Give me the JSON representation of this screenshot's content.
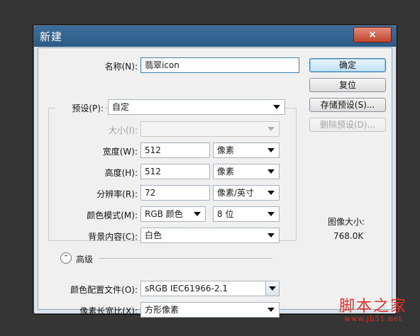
{
  "dialog": {
    "title": "新建",
    "close_label": "×"
  },
  "form": {
    "name": {
      "label": "名称(N):",
      "value": "翡翠icon"
    },
    "preset": {
      "label": "预设(P):",
      "value": "自定"
    },
    "size": {
      "label": "大小(I):",
      "value": ""
    },
    "width": {
      "label": "宽度(W):",
      "value": "512",
      "unit": "像素"
    },
    "height": {
      "label": "高度(H):",
      "value": "512",
      "unit": "像素"
    },
    "resolution": {
      "label": "分辨率(R):",
      "value": "72",
      "unit": "像素/英寸"
    },
    "color_mode": {
      "label": "颜色模式(M):",
      "value": "RGB 颜色",
      "depth": "8 位"
    },
    "background": {
      "label": "背景内容(C):",
      "value": "白色"
    },
    "advanced": {
      "label": "高级",
      "toggle_glyph": "⌃"
    },
    "color_profile": {
      "label": "颜色配置文件(O):",
      "value": "sRGB IEC61966-2.1"
    },
    "pixel_aspect": {
      "label": "像素长宽比(X):",
      "value": "方形像素"
    }
  },
  "buttons": {
    "ok": "确定",
    "reset": "复位",
    "save_preset": "存储预设(S)...",
    "delete_preset": "删除预设(D)..."
  },
  "image_size": {
    "label": "图像大小:",
    "value": "768.0K"
  },
  "watermark": {
    "main": "脚本之家",
    "sub": "www.jb51.net"
  }
}
